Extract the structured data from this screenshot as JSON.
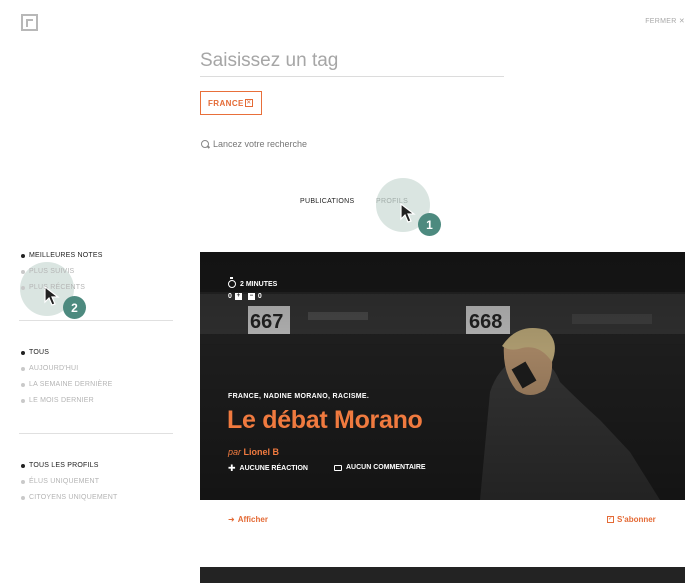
{
  "header": {
    "close_label": "FERMER",
    "close_glyph": "✕"
  },
  "search": {
    "placeholder": "Saisissez un tag",
    "tag_chip": "FRANCE",
    "tag_remove_glyph": "✕",
    "launch_label": "Lancez votre recherche"
  },
  "tabs": [
    {
      "label": "PUBLICATIONS",
      "active": true
    },
    {
      "label": "PROFILS",
      "active": false
    }
  ],
  "tutorial": {
    "step1": "1",
    "step2": "2"
  },
  "filters": {
    "sort": [
      {
        "label": "MEILLEURES NOTES",
        "active": true
      },
      {
        "label": "PLUS SUIVIS",
        "active": false
      },
      {
        "label": "PLUS RÉCENTS",
        "active": false
      }
    ],
    "period": [
      {
        "label": "TOUS",
        "active": true
      },
      {
        "label": "AUJOURD'HUI",
        "active": false
      },
      {
        "label": "LA SEMAINE DERNIÈRE",
        "active": false
      },
      {
        "label": "LE MOIS DERNIER",
        "active": false
      }
    ],
    "profiles": [
      {
        "label": "TOUS LES PROFILS",
        "active": true
      },
      {
        "label": "ÉLUS UNIQUEMENT",
        "active": false
      },
      {
        "label": "CITOYENS UNIQUEMENT",
        "active": false
      }
    ]
  },
  "card": {
    "duration": "2 MINUTES",
    "count_up": "0",
    "count_down": "0",
    "count_up_glyph": "+",
    "count_down_glyph": "−",
    "seat_numbers": [
      "667",
      "668"
    ],
    "tags": "FRANCE, NADINE MORANO, RACISME.",
    "title": "Le débat Morano",
    "author_prefix": "par",
    "author_name": "Lionel B",
    "reactions_label": "AUCUNE RÉACTION",
    "comments_label": "AUCUN COMMENTAIRE"
  },
  "actions": {
    "show_label": "Afficher",
    "show_glyph": "➜",
    "subscribe_label": "S'abonner",
    "subscribe_glyph": "✓"
  },
  "colors": {
    "accent": "#e46a35",
    "tutorial": "#4d8a7f"
  }
}
